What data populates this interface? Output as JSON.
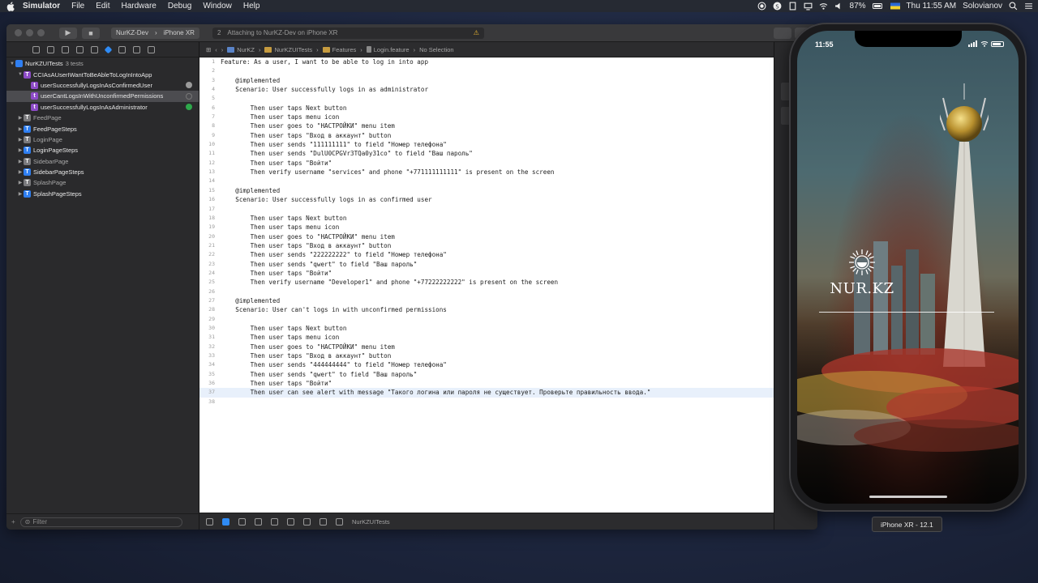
{
  "menubar": {
    "app": "Simulator",
    "items": [
      "File",
      "Edit",
      "Hardware",
      "Debug",
      "Window",
      "Help"
    ],
    "battery": "87%",
    "datetime": "Thu 11:55 AM",
    "user": "Solovianov"
  },
  "toolbar": {
    "scheme": "NurKZ-Dev",
    "device": "iPhone XR",
    "activity_count": "2",
    "activity_text": "Attaching to NurKZ-Dev on iPhone XR",
    "warning_icon": "warning-icon"
  },
  "navigator": {
    "root": {
      "label": "NurKZUITests",
      "count": "3 tests"
    },
    "suite": "CCIAsAUserIWantToBeAbleToLogInIntoApp",
    "tests": [
      {
        "label": "userSuccessfullyLogsInAsConfirmedUser",
        "status": "running"
      },
      {
        "label": "userCantLogsInWithUnconfirmedPermissions",
        "status": "pending",
        "selected": true
      },
      {
        "label": "userSuccessfullyLogsInAsAdministrator",
        "status": "passed"
      }
    ],
    "classes": [
      {
        "label": "FeedPage",
        "dim": true
      },
      {
        "label": "FeedPageSteps",
        "dim": false
      },
      {
        "label": "LoginPage",
        "dim": true
      },
      {
        "label": "LoginPageSteps",
        "dim": false
      },
      {
        "label": "SidebarPage",
        "dim": true
      },
      {
        "label": "SidebarPageSteps",
        "dim": false
      },
      {
        "label": "SplashPage",
        "dim": true
      },
      {
        "label": "SplashPageSteps",
        "dim": false
      }
    ],
    "filter_placeholder": "Filter"
  },
  "jumpbar": {
    "crumbs": [
      "NurKZ",
      "NurKZUITests",
      "Features",
      "Login.feature",
      "No Selection"
    ]
  },
  "editor": {
    "highlight_line": 37,
    "lines": [
      "Feature: As a user, I want to be able to log in into app",
      "",
      "    @implemented",
      "    Scenario: User successfully logs in as administrator",
      "",
      "        Then user taps Next button",
      "        Then user taps menu icon",
      "        Then user goes to \"НАСТРОЙКИ\" menu item",
      "        Then user taps \"Вход в аккаунт\" button",
      "        Then user sends \"111111111\" to field \"Номер телефона\"",
      "        Then user sends \"DulU0CPGVr3TQa0y31co\" to field \"Ваш пароль\"",
      "        Then user taps \"Войти\"",
      "        Then verify username \"services\" and phone \"+771111111111\" is present on the screen",
      "",
      "    @implemented",
      "    Scenario: User successfully logs in as confirmed user",
      "",
      "        Then user taps Next button",
      "        Then user taps menu icon",
      "        Then user goes to \"НАСТРОЙКИ\" menu item",
      "        Then user taps \"Вход в аккаунт\" button",
      "        Then user sends \"222222222\" to field \"Номер телефона\"",
      "        Then user sends \"qwert\" to field \"Ваш пароль\"",
      "        Then user taps \"Войти\"",
      "        Then verify username \"Developer1\" and phone \"+77222222222\" is present on the screen",
      "",
      "    @implemented",
      "    Scenario: User can't logs in with unconfirmed permissions",
      "",
      "        Then user taps Next button",
      "        Then user taps menu icon",
      "        Then user goes to \"НАСТРОЙКИ\" menu item",
      "        Then user taps \"Вход в аккаунт\" button",
      "        Then user sends \"444444444\" to field \"Номер телефона\"",
      "        Then user sends \"qwert\" to field \"Ваш пароль\"",
      "        Then user taps \"Войти\"",
      "        Then user can see alert with message \"Такого логина или пароля не существует. Проверьте правильность ввода.\"",
      ""
    ]
  },
  "editor_bottom": {
    "target": "NurKZUITests"
  },
  "phone": {
    "time": "11:55",
    "logo": "NUR.KZ"
  },
  "device_label": "iPhone XR - 12.1"
}
